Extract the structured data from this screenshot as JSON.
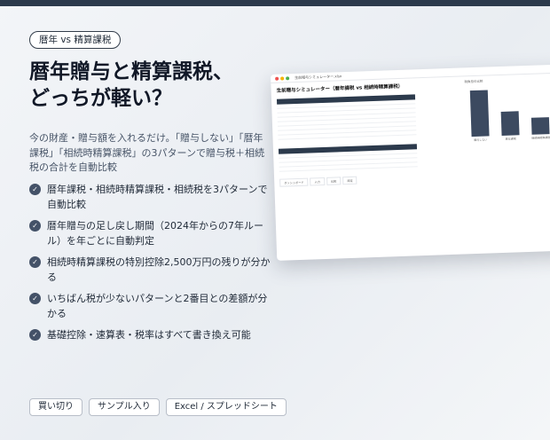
{
  "tag": "暦年 vs 精算課税",
  "title": {
    "line1": "暦年贈与と精算課税、",
    "line2": "どっちが軽い？"
  },
  "lead": "今の財産・贈与額を入れるだけ。「贈与しない」「暦年課税」「相続時精算課税」の3パターンで贈与税＋相続税の合計を自動比較",
  "features": [
    "暦年課税・相続時精算課税・相続税を3パターンで自動比較",
    "暦年贈与の足し戻し期間（2024年からの7年ルール）を年ごとに自動判定",
    "相続時精算課税の特別控除2,500万円の残りが分かる",
    "いちばん税が少ないパターンと2番目との差額が分かる",
    "基礎控除・速算表・税率はすべて書き換え可能"
  ],
  "badges": [
    "買い切り",
    "サンプル入り",
    "Excel / スプレッドシート"
  ],
  "sheet": {
    "file_name": "生前贈与シミュレーター.xlsx",
    "title": "生前贈与シミュレーター（暦年課税 vs 相続時精算課税）",
    "tabs": [
      "ダッシュボード",
      "入力",
      "比較",
      "設定"
    ]
  },
  "chart_data": {
    "type": "bar",
    "categories": [
      "贈与しない",
      "暦年課税",
      "相続時精算課税"
    ],
    "values": [
      100,
      52,
      36
    ],
    "title": "税負担の比較",
    "xlabel": "",
    "ylabel": "",
    "ylim": [
      0,
      100
    ]
  },
  "colors": {
    "accent": "#2c3a4c",
    "check": "#445268",
    "bar": "#3c4a60"
  }
}
